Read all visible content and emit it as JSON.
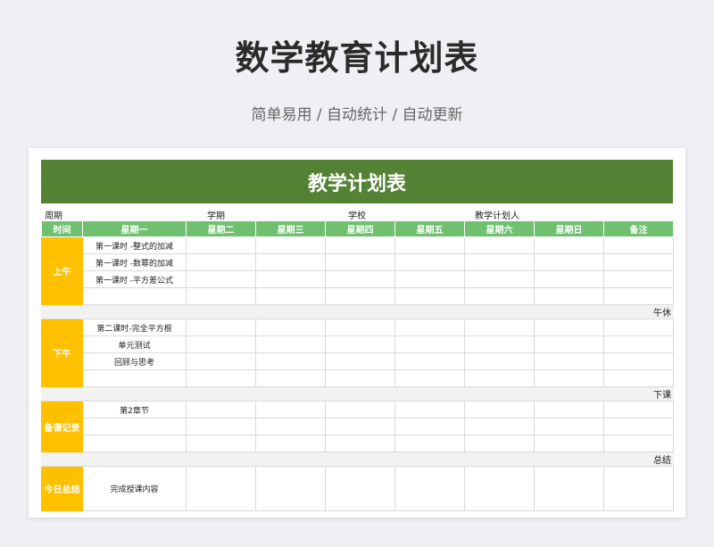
{
  "page": {
    "title": "数学教育计划表",
    "subtitle": "简单易用 / 自动统计 / 自动更新"
  },
  "sheet": {
    "banner": "教学计划表",
    "info": {
      "period_label": "周期",
      "term_label": "学期",
      "school_label": "学校",
      "planner_label": "教学计划人"
    },
    "headers": [
      "时间",
      "星期一",
      "星期二",
      "星期三",
      "星期四",
      "星期五",
      "星期六",
      "星期日",
      "备注"
    ],
    "sections": [
      {
        "label": "上午",
        "rows": [
          "第一课时 -整式的加减",
          "第一课时 -数幂的加减",
          "第一课时 -平方差公式",
          ""
        ],
        "separator": "午休"
      },
      {
        "label": "下午",
        "rows": [
          "第二课时-完全平方根",
          "单元测试",
          "回顾与思考",
          ""
        ],
        "separator": "下课"
      },
      {
        "label": "备课记录",
        "rows": [
          "第2章节",
          "",
          ""
        ],
        "separator": "总结"
      },
      {
        "label": "今日总结",
        "rows": [
          "完成授课内容"
        ],
        "separator": ""
      }
    ]
  },
  "colors": {
    "banner": "#548235",
    "header": "#70c070",
    "period": "#ffc000",
    "separator": "#f2f2f2"
  }
}
